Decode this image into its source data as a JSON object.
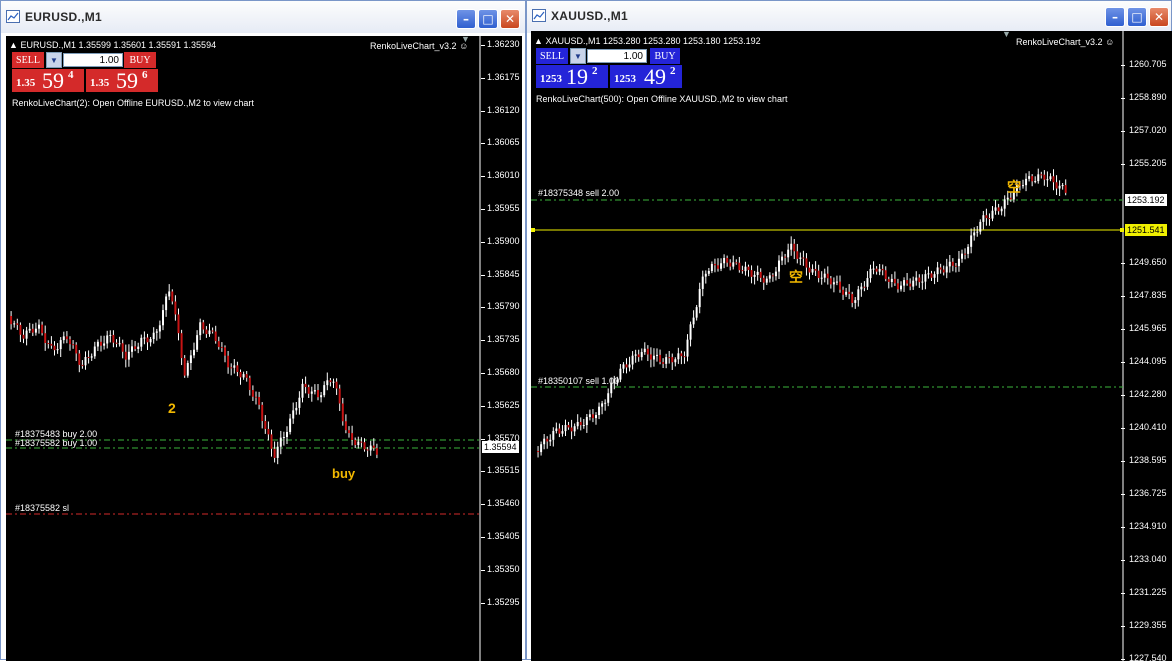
{
  "eur": {
    "window_title": "EURUSD.,M1",
    "info_line": "EURUSD.,M1  1.35599 1.35601 1.35591 1.35594",
    "indicator_corner": "RenkoLiveChart_v3.2",
    "sell_label": "SELL",
    "buy_label": "BUY",
    "lot": "1.00",
    "sell_price_small": "1.35",
    "sell_price_big": "59",
    "sell_price_sup": "4",
    "buy_price_small": "1.35",
    "buy_price_big": "59",
    "buy_price_sup": "6",
    "indicator_message": "RenkoLiveChart(2): Open Offline EURUSD.,M2 to view chart",
    "axis_labels": [
      "1.36230",
      "1.36175",
      "1.36120",
      "1.36065",
      "1.36010",
      "1.35955",
      "1.35900",
      "1.35845",
      "1.35790",
      "1.35735",
      "1.35680",
      "1.35625",
      "1.35570",
      "1.35515",
      "1.35460",
      "1.35405",
      "1.35350",
      "1.35295"
    ],
    "current_price": "1.35594",
    "orders": [
      "#18375483 buy 2.00",
      "#18375582 buy 1.00",
      "#18375582 sl"
    ],
    "annotation_2": "2",
    "annotation_buy": "buy"
  },
  "xau": {
    "window_title": "XAUUSD.,M1",
    "info_line": "XAUUSD.,M1  1253.280 1253.280 1253.180 1253.192",
    "indicator_corner": "RenkoLiveChart_v3.2",
    "sell_label": "SELL",
    "buy_label": "BUY",
    "lot": "1.00",
    "sell_price_small": "1253",
    "sell_price_big": "19",
    "sell_price_sup": "2",
    "buy_price_small": "1253",
    "buy_price_big": "49",
    "buy_price_sup": "2",
    "indicator_message": "RenkoLiveChart(500): Open Offline XAUUSD.,M2 to view chart",
    "axis_labels": [
      "1260.705",
      "1258.890",
      "1257.020",
      "1255.205",
      "1253.192",
      "1251.541",
      "1249.650",
      "1247.835",
      "1245.965",
      "1244.095",
      "1242.280",
      "1240.410",
      "1238.595",
      "1236.725",
      "1234.910",
      "1233.040",
      "1231.225",
      "1229.355",
      "1227.540"
    ],
    "current_price": "1253.192",
    "line_price": "1251.541",
    "orders": [
      "#18375348 sell 2.00",
      "#18350107 sell 1.00"
    ],
    "annotation_1": "空",
    "annotation_2": "空"
  },
  "colors": {
    "sell_red": "#d42a2a",
    "buy_blue": "#2424d8",
    "order_green": "#3cb43c",
    "sl_red": "#d22a2a",
    "yellow_line": "#f0f000",
    "candle_red": "#c81414",
    "candle_white": "#ffffff"
  },
  "icons": [
    "chart-window-icon",
    "minimize-icon",
    "maximize-icon",
    "close-icon",
    "dropdown-arrow-icon",
    "smiley-icon"
  ]
}
